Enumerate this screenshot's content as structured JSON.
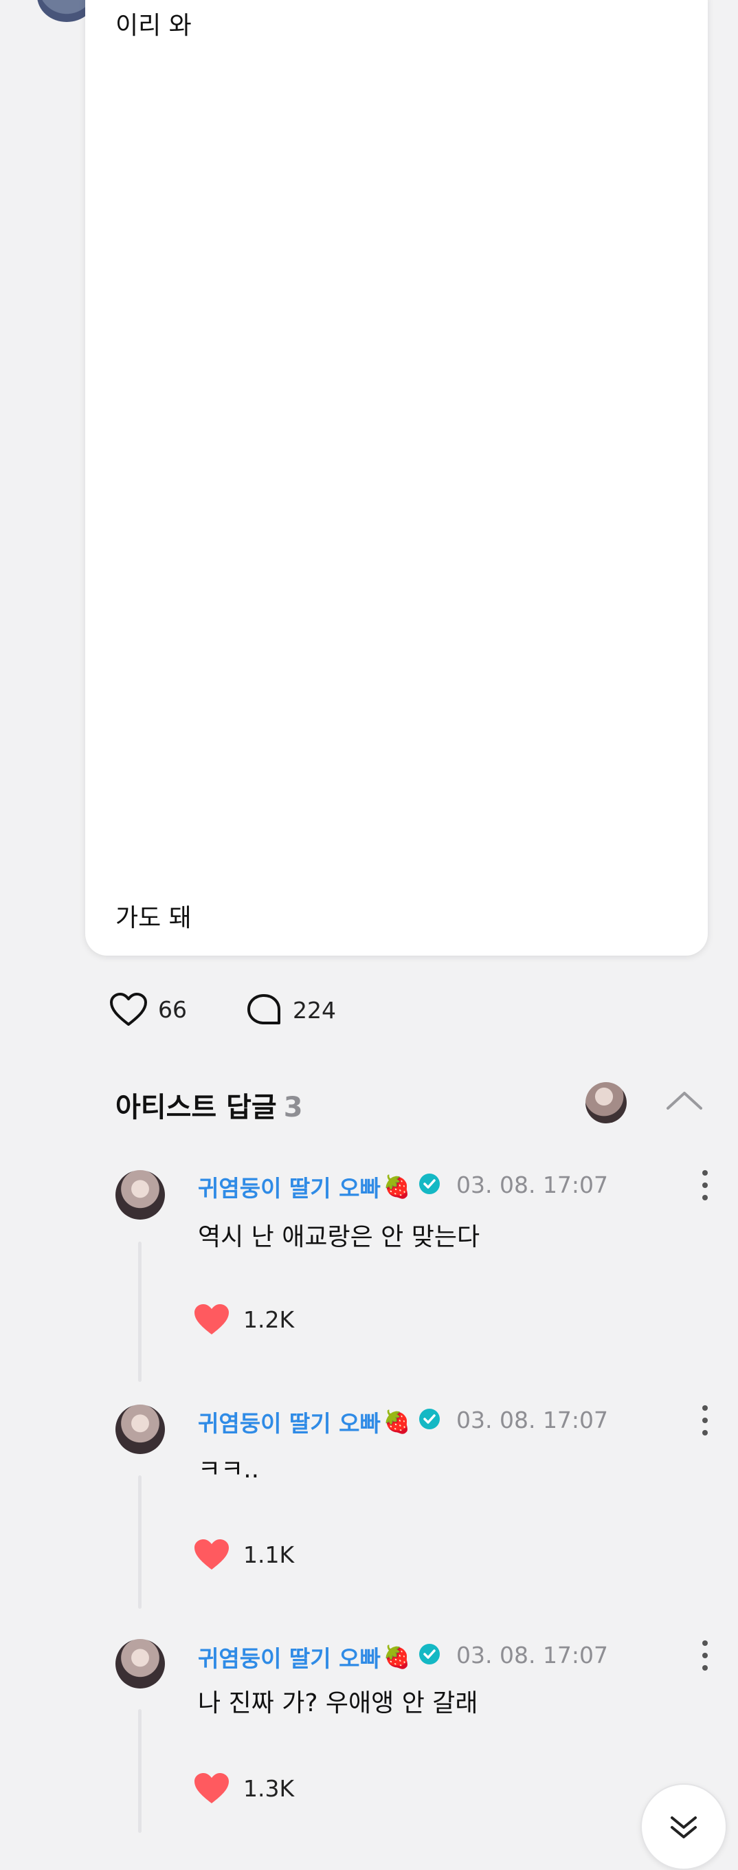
{
  "post": {
    "text_top": "이리 와",
    "text_bottom": "가도 돼"
  },
  "stats": {
    "likes": "66",
    "comments": "224"
  },
  "replies_header": {
    "title": "아티스트 답글",
    "count": "3"
  },
  "comments": [
    {
      "name": "귀염둥이 딸기 오빠",
      "emoji": "🍓",
      "time": "03. 08. 17:07",
      "text": "역시 난 애교랑은 안 맞는다",
      "likes": "1.2K"
    },
    {
      "name": "귀염둥이 딸기 오빠",
      "emoji": "🍓",
      "time": "03. 08. 17:07",
      "text": "ㅋㅋ..",
      "likes": "1.1K"
    },
    {
      "name": "귀염둥이 딸기 오빠",
      "emoji": "🍓",
      "time": "03. 08. 17:07",
      "text": "나 진짜 가? 우애앵 안 갈래",
      "likes": "1.3K"
    }
  ],
  "colors": {
    "accent": "#2f8be6",
    "heart": "#ff5a5f",
    "verified": "#14b8c4",
    "muted": "#8e8e93"
  },
  "icons": {
    "like": "heart-outline-icon",
    "comment": "speech-bubble-icon",
    "comment_like": "heart-filled-icon",
    "verified": "verified-badge-icon",
    "more": "more-vertical-icon",
    "collapse": "chevron-up-icon",
    "scroll": "double-chevron-down-icon"
  }
}
